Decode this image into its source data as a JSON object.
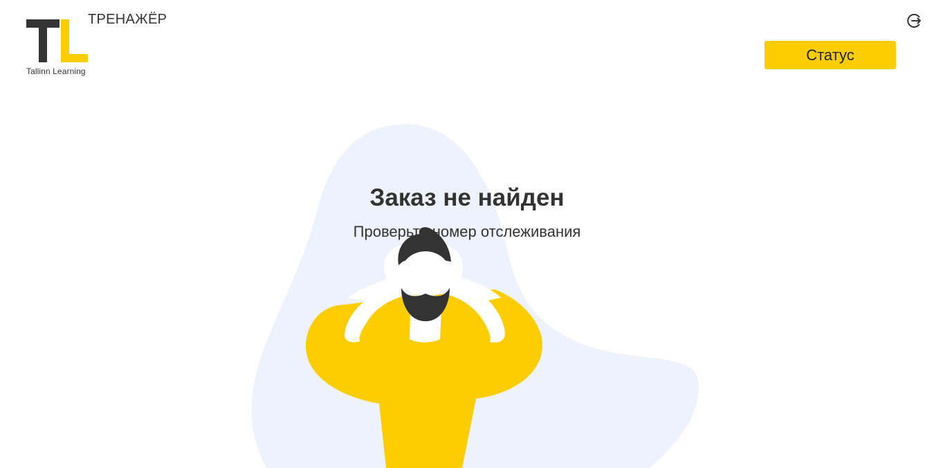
{
  "header": {
    "logo_letters": "TL",
    "logo_caption": "Tallinn Learning",
    "app_title": "ТРЕНАЖЁР",
    "logout_icon": "logout-icon",
    "status_button_label": "Статус"
  },
  "main": {
    "title": "Заказ не найден",
    "subtitle": "Проверьте номер отслеживания",
    "illustration": "confused-man-illustration"
  },
  "colors": {
    "accent": "#FCCD00",
    "dark": "#333333",
    "blob": "#EEF2FC",
    "background": "#FFFFFF"
  }
}
